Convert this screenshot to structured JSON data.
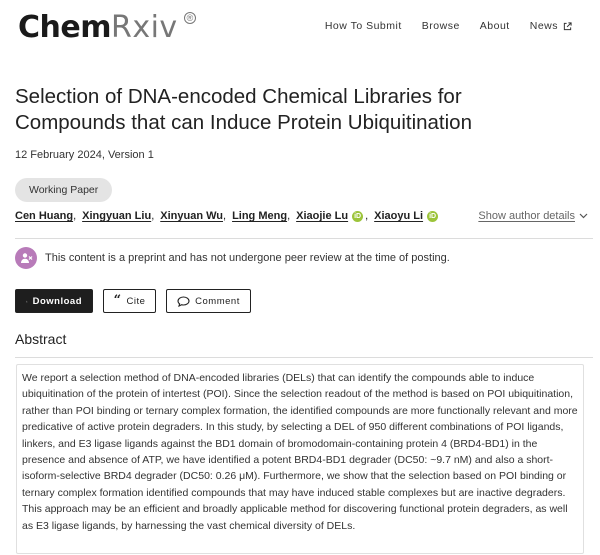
{
  "header": {
    "logo_primary": "Chem",
    "logo_secondary": "Rxiv",
    "logo_mark": "®",
    "nav": [
      {
        "label": "How To Submit"
      },
      {
        "label": "Browse"
      },
      {
        "label": "About"
      },
      {
        "label": "News",
        "icon": "external-link-icon"
      }
    ]
  },
  "article": {
    "title": "Selection of DNA-encoded Chemical Libraries for Compounds that can Induce Protein Ubiquitination",
    "date_version": "12 February 2024, Version 1",
    "badge": "Working Paper",
    "authors": [
      {
        "name": "Cen Huang",
        "orcid": false
      },
      {
        "name": "Xingyuan Liu",
        "orcid": false
      },
      {
        "name": "Xinyuan Wu",
        "orcid": false
      },
      {
        "name": "Ling Meng",
        "orcid": false
      },
      {
        "name": "Xiaojie Lu",
        "orcid": true
      },
      {
        "name": "Xiaoyu Li",
        "orcid": true
      }
    ],
    "show_details": "Show author details",
    "notice": "This content is a preprint and has not undergone peer review at the time of posting.",
    "buttons": {
      "download": "Download",
      "cite": "Cite",
      "comment": "Comment"
    },
    "abstract_heading": "Abstract",
    "abstract_text": "We report a selection method of DNA-encoded libraries (DELs) that can identify the compounds able to induce ubiquitination of the protein of intertest (POI). Since the selection readout of the method is based on POI ubiquitination, rather than POI binding or ternary complex formation, the identified compounds are more functionally relevant and more predicative of active protein degraders. In this study, by selecting a DEL of 950 different combinations of POI ligands, linkers, and E3 ligase ligands against the BD1 domain of bromodomain-containing protein 4 (BRD4-BD1) in the presence and absence of ATP, we have identified a potent BRD4-BD1 degrader (DC50: ~9.7 nM) and also a short-isoform-selective BRD4 degrader (DC50: 0.26 μM). Furthermore, we show that the selection based on POI binding or ternary complex formation identified compounds that may have induced stable complexes but are inactive degraders. This approach may be an efficient and broadly applicable method for discovering functional protein degraders, as well as E3 ligase ligands, by harnessing the vast chemical diversity of DELs."
  },
  "colors": {
    "orcid": "#9cc43a",
    "notice_icon": "#b87bb9",
    "download_bg": "#1e1e1e",
    "badge_bg": "#e4e4e4"
  }
}
